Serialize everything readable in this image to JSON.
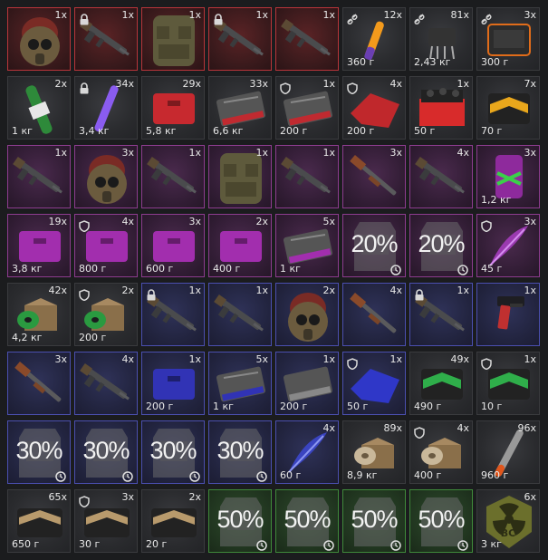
{
  "rarity_colors": {
    "red": "#b8353a",
    "purple": "#8d3c8f",
    "blue": "#4b4fb0",
    "green": "#3f8a3a",
    "grey": "#3a3b3e"
  },
  "items": [
    {
      "qty": "1x",
      "rarity": "red",
      "icon": "gas-mask-helmet",
      "badge": "none"
    },
    {
      "qty": "1x",
      "rarity": "red",
      "icon": "rifle",
      "badge": "lock"
    },
    {
      "qty": "1x",
      "rarity": "red",
      "icon": "armor-vest",
      "badge": "none"
    },
    {
      "qty": "1x",
      "rarity": "red",
      "icon": "rifle",
      "badge": "lock"
    },
    {
      "qty": "1x",
      "rarity": "red",
      "icon": "rifle",
      "badge": "none"
    },
    {
      "qty": "12x",
      "weight": "360 г",
      "rarity": "grey",
      "icon": "glowstick-orange",
      "badge": "chain"
    },
    {
      "qty": "81x",
      "weight": "2,43 кг",
      "rarity": "grey",
      "icon": "detonator",
      "badge": "chain"
    },
    {
      "qty": "3x",
      "weight": "300 г",
      "rarity": "grey",
      "icon": "tablet-orange",
      "badge": "chain"
    },
    {
      "qty": "2x",
      "weight": "1 кг",
      "rarity": "grey",
      "icon": "bottle-green",
      "badge": "none"
    },
    {
      "qty": "34x",
      "weight": "3,4 кг",
      "rarity": "grey",
      "icon": "glowstick-purple",
      "badge": "lock"
    },
    {
      "qty": "29x",
      "weight": "5,8 кг",
      "rarity": "grey",
      "icon": "case-red",
      "badge": "none"
    },
    {
      "qty": "33x",
      "weight": "6,6 кг",
      "rarity": "grey",
      "icon": "ammo-box-red",
      "badge": "none"
    },
    {
      "qty": "1x",
      "weight": "200 г",
      "rarity": "grey",
      "icon": "ammo-box-red",
      "badge": "shield"
    },
    {
      "qty": "4x",
      "weight": "200 г",
      "rarity": "grey",
      "icon": "cloth-red",
      "badge": "shield"
    },
    {
      "qty": "1x",
      "weight": "50 г",
      "rarity": "grey",
      "icon": "crate-red",
      "badge": "none"
    },
    {
      "qty": "7x",
      "weight": "70 г",
      "rarity": "grey",
      "icon": "case-yellow",
      "badge": "none"
    },
    {
      "qty": "1x",
      "rarity": "purple",
      "icon": "rifle",
      "badge": "none"
    },
    {
      "qty": "3x",
      "rarity": "purple",
      "icon": "gas-mask-helmet",
      "badge": "none"
    },
    {
      "qty": "1x",
      "rarity": "purple",
      "icon": "rifle",
      "badge": "none"
    },
    {
      "qty": "1x",
      "rarity": "purple",
      "icon": "armor-vest",
      "badge": "none"
    },
    {
      "qty": "1x",
      "rarity": "purple",
      "icon": "rifle",
      "badge": "none"
    },
    {
      "qty": "3x",
      "rarity": "purple",
      "icon": "shotgun",
      "badge": "none"
    },
    {
      "qty": "4x",
      "rarity": "purple",
      "icon": "rifle",
      "badge": "none"
    },
    {
      "qty": "3x",
      "weight": "1,2 кг",
      "rarity": "purple",
      "icon": "can-purple",
      "badge": "none"
    },
    {
      "qty": "19x",
      "weight": "3,8 кг",
      "rarity": "purple",
      "icon": "case-purple",
      "badge": "none"
    },
    {
      "qty": "4x",
      "weight": "800 г",
      "rarity": "purple",
      "icon": "case-purple",
      "badge": "shield"
    },
    {
      "qty": "3x",
      "weight": "600 г",
      "rarity": "purple",
      "icon": "case-purple",
      "badge": "none"
    },
    {
      "qty": "2x",
      "weight": "400 г",
      "rarity": "purple",
      "icon": "case-purple",
      "badge": "none"
    },
    {
      "qty": "5x",
      "weight": "1 кг",
      "rarity": "purple",
      "icon": "ammo-box-purple",
      "badge": "none"
    },
    {
      "percent": "20%",
      "rarity": "purple",
      "icon": "armor-plate",
      "badge": "none",
      "timer": true
    },
    {
      "percent": "20%",
      "rarity": "purple",
      "icon": "armor-plate",
      "badge": "none",
      "timer": true
    },
    {
      "qty": "3x",
      "weight": "45 г",
      "rarity": "purple",
      "icon": "feather-purple",
      "badge": "shield"
    },
    {
      "qty": "42x",
      "weight": "4,2 кг",
      "rarity": "grey",
      "icon": "box-green",
      "badge": "none"
    },
    {
      "qty": "2x",
      "weight": "200 г",
      "rarity": "grey",
      "icon": "box-green",
      "badge": "shield"
    },
    {
      "qty": "1x",
      "rarity": "blue",
      "icon": "rifle",
      "badge": "lock"
    },
    {
      "qty": "1x",
      "rarity": "blue",
      "icon": "rifle",
      "badge": "none"
    },
    {
      "qty": "2x",
      "rarity": "blue",
      "icon": "gas-mask-helmet",
      "badge": "none"
    },
    {
      "qty": "4x",
      "rarity": "blue",
      "icon": "shotgun",
      "badge": "none"
    },
    {
      "qty": "1x",
      "rarity": "blue",
      "icon": "rifle",
      "badge": "lock"
    },
    {
      "qty": "1x",
      "rarity": "blue",
      "icon": "pistol",
      "badge": "none"
    },
    {
      "qty": "3x",
      "rarity": "blue",
      "icon": "shotgun",
      "badge": "none"
    },
    {
      "qty": "4x",
      "rarity": "blue",
      "icon": "rifle",
      "badge": "none"
    },
    {
      "qty": "1x",
      "weight": "200 г",
      "rarity": "blue",
      "icon": "case-blue",
      "badge": "none"
    },
    {
      "qty": "5x",
      "weight": "1 кг",
      "rarity": "blue",
      "icon": "ammo-box-blue",
      "badge": "none"
    },
    {
      "qty": "1x",
      "weight": "200 г",
      "rarity": "blue",
      "icon": "ammo-box-grey",
      "badge": "none"
    },
    {
      "qty": "1x",
      "weight": "50 г",
      "rarity": "blue",
      "icon": "cloth-blue",
      "badge": "shield"
    },
    {
      "qty": "49x",
      "weight": "490 г",
      "rarity": "grey",
      "icon": "case-green",
      "badge": "none"
    },
    {
      "qty": "1x",
      "weight": "10 г",
      "rarity": "grey",
      "icon": "case-green",
      "badge": "shield"
    },
    {
      "percent": "30%",
      "rarity": "blue",
      "icon": "armor-plate",
      "badge": "none",
      "timer": true
    },
    {
      "percent": "30%",
      "rarity": "blue",
      "icon": "armor-plate",
      "badge": "none",
      "timer": true
    },
    {
      "percent": "30%",
      "rarity": "blue",
      "icon": "armor-plate",
      "badge": "none",
      "timer": true
    },
    {
      "percent": "30%",
      "rarity": "blue",
      "icon": "armor-plate",
      "badge": "none",
      "timer": true
    },
    {
      "qty": "4x",
      "weight": "60 г",
      "rarity": "blue",
      "icon": "feather-blue",
      "badge": "none"
    },
    {
      "qty": "89x",
      "weight": "8,9 кг",
      "rarity": "grey",
      "icon": "box-tan",
      "badge": "none"
    },
    {
      "qty": "4x",
      "weight": "400 г",
      "rarity": "grey",
      "icon": "box-tan",
      "badge": "shield"
    },
    {
      "qty": "96x",
      "weight": "960 г",
      "rarity": "grey",
      "icon": "flare-stick",
      "badge": "none"
    },
    {
      "qty": "65x",
      "weight": "650 г",
      "rarity": "grey",
      "icon": "case-tan",
      "badge": "none"
    },
    {
      "qty": "3x",
      "weight": "30 г",
      "rarity": "grey",
      "icon": "case-tan",
      "badge": "shield"
    },
    {
      "qty": "2x",
      "weight": "20 г",
      "rarity": "grey",
      "icon": "case-tan",
      "badge": "none"
    },
    {
      "percent": "50%",
      "rarity": "green",
      "icon": "armor-plate",
      "badge": "none",
      "timer": true
    },
    {
      "percent": "50%",
      "rarity": "green",
      "icon": "armor-plate",
      "badge": "none",
      "timer": true
    },
    {
      "percent": "50%",
      "rarity": "green",
      "icon": "armor-plate",
      "badge": "none",
      "timer": true
    },
    {
      "percent": "50%",
      "rarity": "green",
      "icon": "armor-plate",
      "badge": "none",
      "timer": true
    },
    {
      "qty": "6x",
      "weight": "3 кг",
      "rarity": "grey",
      "icon": "radiation-badge",
      "badge": "none",
      "emblem": "BC"
    }
  ]
}
